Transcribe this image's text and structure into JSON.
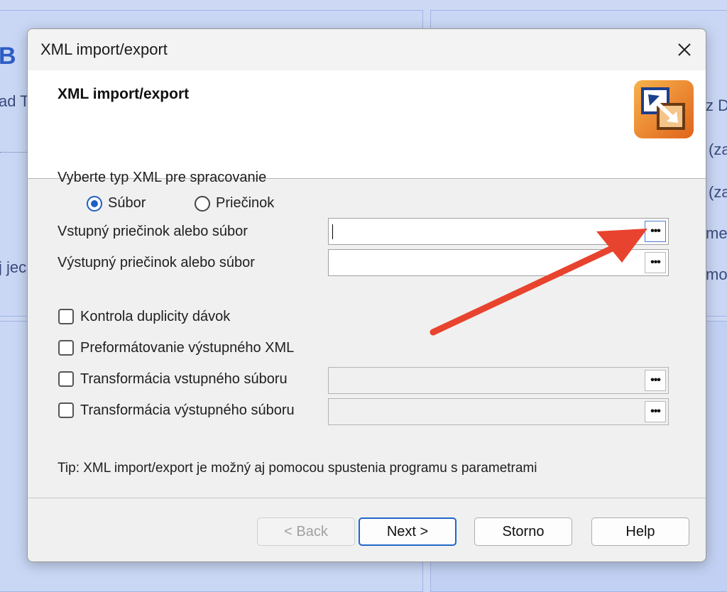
{
  "background": {
    "big_letter": "B",
    "left_text_1": "ad T",
    "left_text_2": "j jec",
    "right_text_1": "z D",
    "right_text_2": "(za",
    "right_text_3": "(za",
    "right_text_4": "mes",
    "right_text_5": "moc"
  },
  "dialog": {
    "window_title": "XML import/export",
    "close_icon": "close-icon",
    "header_title": "XML import/export",
    "header_icon": "xml-import-export-icon",
    "xml_type_label": "Vyberte typ XML pre spracovanie",
    "radio_file_label": "Súbor",
    "radio_folder_label": "Priečinok",
    "selected_type": "Súbor",
    "input_label": "Vstupný priečinok alebo súbor",
    "input_value": "",
    "output_label": "Výstupný priečinok alebo súbor",
    "output_value": "",
    "browse_label": "•••",
    "check_duplicity_label": "Kontrola duplicity dávok",
    "check_preformat_label": "Preformátovanie výstupného XML",
    "check_transform_in_label": "Transformácia vstupného súboru",
    "check_transform_out_label": "Transformácia výstupného súboru",
    "tip_text": "Tip: XML import/export je možný aj pomocou spustenia programu s parametrami",
    "buttons": {
      "back": "< Back",
      "next": "Next >",
      "cancel": "Storno",
      "help": "Help"
    }
  },
  "colors": {
    "accent": "#1f5fc5",
    "annotation_arrow": "#e8432e",
    "background": "#cdd9f4"
  }
}
